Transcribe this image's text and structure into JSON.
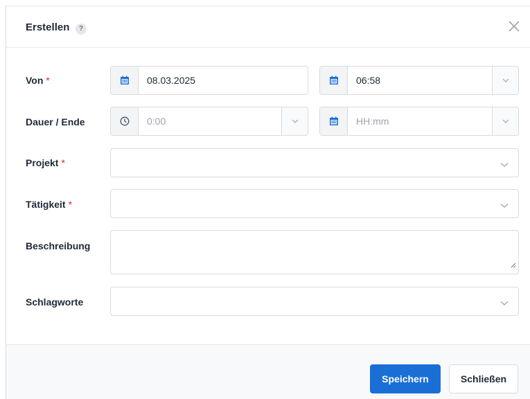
{
  "dialog": {
    "title": "Erstellen",
    "help_badge": "?",
    "close_icon": "close-icon"
  },
  "form": {
    "required_mark": "*",
    "von": {
      "label": "Von",
      "date_value": "08.03.2025",
      "time_value": "06:58",
      "icons": [
        "calendar-icon",
        "chevron-down-icon"
      ]
    },
    "dauer": {
      "label": "Dauer / Ende",
      "duration_placeholder": "0:00",
      "end_placeholder": "HH:mm",
      "icons": [
        "clock-icon",
        "calendar-icon",
        "chevron-down-icon"
      ]
    },
    "projekt": {
      "label": "Projekt",
      "value": ""
    },
    "taetigkeit": {
      "label": "Tätigkeit",
      "value": ""
    },
    "beschreibung": {
      "label": "Beschreibung",
      "value": ""
    },
    "schlagworte": {
      "label": "Schlagworte",
      "value": ""
    }
  },
  "footer": {
    "save_label": "Speichern",
    "close_label": "Schließen"
  },
  "colors": {
    "primary": "#1a6fd6",
    "required": "#dc2626",
    "icon_blue": "#1a6fd6"
  }
}
